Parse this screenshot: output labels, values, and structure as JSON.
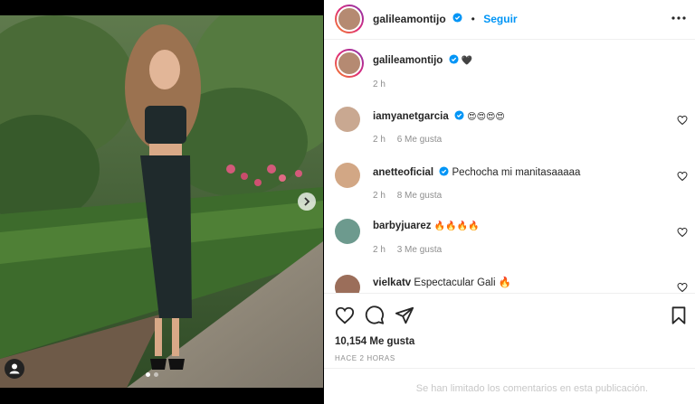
{
  "post": {
    "username": "galileamontijo",
    "follow_label": "Seguir",
    "separator": "•",
    "caption_text": "🖤",
    "caption_age": "2 h",
    "likes": "10,154 Me gusta",
    "time_ago": "HACE 2 HORAS",
    "comments_limited": "Se han limitado los comentarios en esta publicación.",
    "carousel_dots": 2,
    "carousel_active": 0
  },
  "comments": [
    {
      "username": "iamyanetgarcia",
      "verified": true,
      "text": "😍😍😍😍",
      "age": "2 h",
      "likes": "6 Me gusta"
    },
    {
      "username": "anetteoficial",
      "verified": true,
      "text": "Pechocha mi manitasaaaaa",
      "age": "2 h",
      "likes": "8 Me gusta"
    },
    {
      "username": "barbyjuarez",
      "verified": false,
      "text": "🔥🔥🔥🔥",
      "age": "2 h",
      "likes": "3 Me gusta"
    },
    {
      "username": "vielkatv",
      "verified": false,
      "text": "Espectacular Gali 🔥",
      "age": "",
      "likes": ""
    }
  ],
  "colors": {
    "accent": "#0095f6",
    "text": "#262626",
    "muted": "#8e8e8e"
  },
  "icons": [
    "more-options-icon",
    "heart-icon",
    "comment-icon",
    "share-icon",
    "bookmark-icon",
    "next-arrow-icon",
    "user-tag-icon",
    "verified-badge-icon"
  ]
}
